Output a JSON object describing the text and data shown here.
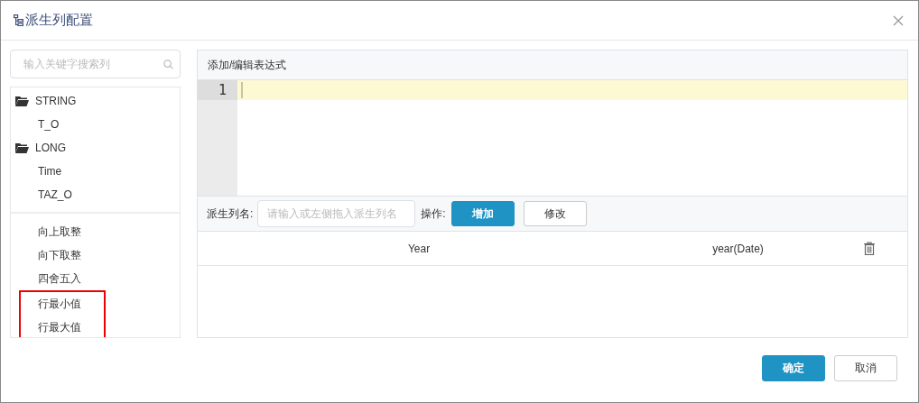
{
  "dialog": {
    "title": "派生列配置"
  },
  "search": {
    "placeholder": "输入关键字搜索列"
  },
  "field_tree": [
    {
      "label": "STRING",
      "children": [
        {
          "label": "T_O"
        }
      ]
    },
    {
      "label": "LONG",
      "children": [
        {
          "label": "Time"
        },
        {
          "label": "TAZ_O"
        }
      ]
    }
  ],
  "functions": [
    {
      "label": "向上取整",
      "highlighted": false
    },
    {
      "label": "向下取整",
      "highlighted": false
    },
    {
      "label": "四舍五入",
      "highlighted": false
    },
    {
      "label": "行最小值",
      "highlighted": true
    },
    {
      "label": "行最大值",
      "highlighted": true
    }
  ],
  "expression_panel": {
    "title": "添加/编辑表达式",
    "line_numbers": [
      "1"
    ]
  },
  "derived_column": {
    "label": "派生列名:",
    "placeholder": "请输入或左侧拖入派生列名",
    "operation_label": "操作:",
    "buttons": [
      {
        "label": "增加",
        "primary": true
      },
      {
        "label": "修改",
        "primary": false
      }
    ]
  },
  "table": {
    "rows": [
      {
        "name": "Year",
        "expression": "year(Date)"
      }
    ]
  },
  "footer_buttons": [
    {
      "label": "确定",
      "primary": true
    },
    {
      "label": "取消",
      "primary": false
    }
  ]
}
